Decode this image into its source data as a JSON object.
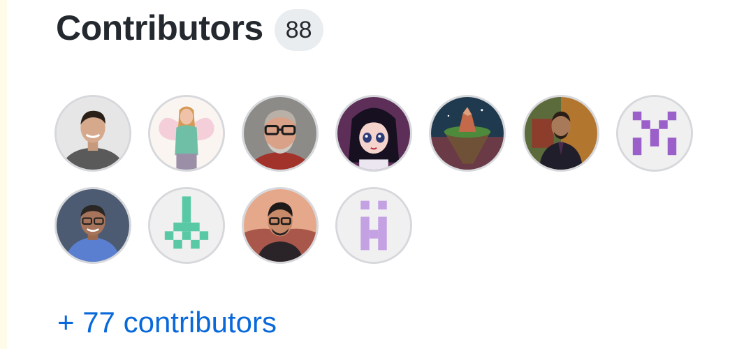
{
  "header": {
    "title": "Contributors",
    "count": "88"
  },
  "avatars": [
    {
      "name": "avatar-1-icon",
      "desc": "man in grey t-shirt"
    },
    {
      "name": "avatar-2-icon",
      "desc": "illustrated fairy woman"
    },
    {
      "name": "avatar-3-icon",
      "desc": "man with glasses and beard"
    },
    {
      "name": "avatar-4-icon",
      "desc": "anime girl"
    },
    {
      "name": "avatar-5-icon",
      "desc": "floating island"
    },
    {
      "name": "avatar-6-icon",
      "desc": "man in suit outdoors"
    },
    {
      "name": "avatar-7-icon",
      "desc": "purple identicon"
    },
    {
      "name": "avatar-8-icon",
      "desc": "man in blue shirt"
    },
    {
      "name": "avatar-9-icon",
      "desc": "teal identicon"
    },
    {
      "name": "avatar-10-icon",
      "desc": "illustrated man with glasses"
    },
    {
      "name": "avatar-11-icon",
      "desc": "lavender identicon"
    }
  ],
  "more_link": "+ 77 contributors",
  "colors": {
    "link": "#0969da",
    "title": "#24292f",
    "badge_bg": "#eaedf0"
  }
}
